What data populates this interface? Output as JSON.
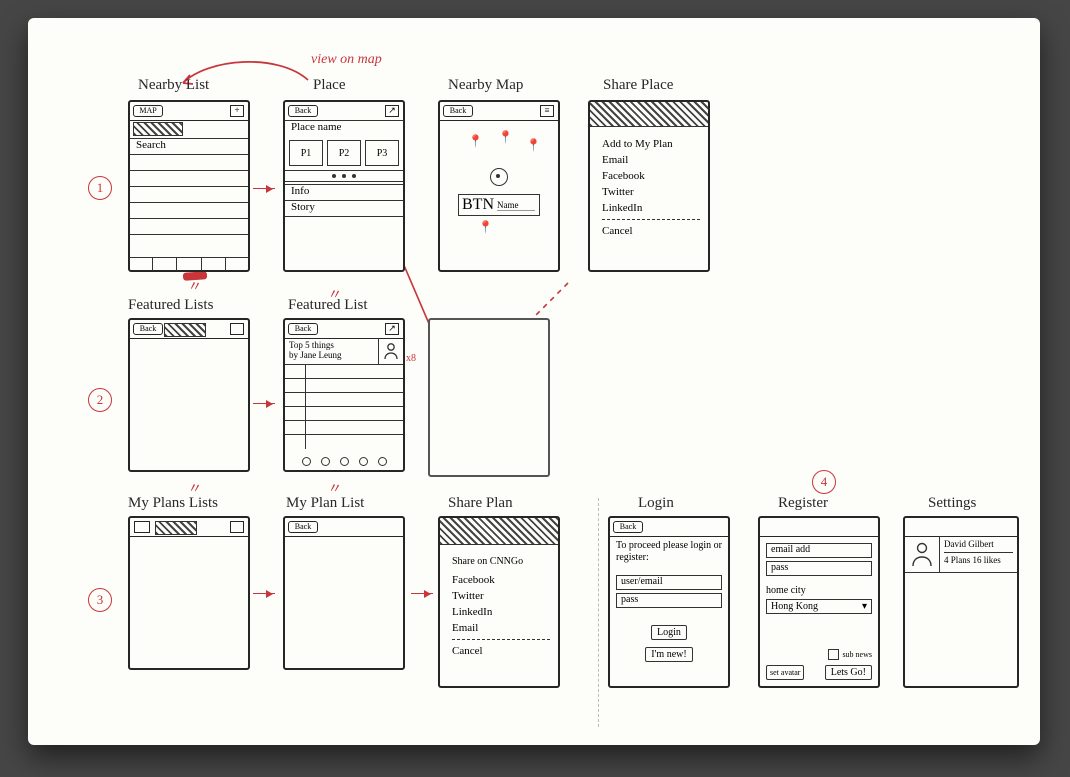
{
  "annotations": {
    "view_on_map": "view on map",
    "row_labels": [
      "1",
      "2",
      "3",
      "4"
    ],
    "x_note": "x8"
  },
  "screens": {
    "nearby_list": {
      "title": "Nearby List",
      "topbar_left": "MAP",
      "topbar_right": "+",
      "search": "Search"
    },
    "place": {
      "title": "Place",
      "back": "Back",
      "share_icon": "↗",
      "name": "Place name",
      "photos": [
        "P1",
        "P2",
        "P3"
      ],
      "info": "Info",
      "story": "Story"
    },
    "nearby_map": {
      "title": "Nearby Map",
      "back": "Back",
      "list_icon": "≡",
      "callout_btn": "BTN",
      "callout_name": "Name"
    },
    "share_place": {
      "title": "Share Place",
      "items": [
        "Add to My Plan",
        "Email",
        "Facebook",
        "Twitter",
        "LinkedIn"
      ],
      "cancel": "Cancel"
    },
    "featured_lists": {
      "title": "Featured Lists",
      "back": "Back"
    },
    "featured_list": {
      "title": "Featured List",
      "back": "Back",
      "list_title": "Top 5 things",
      "byline": "by Jane Leung"
    },
    "my_plans_lists": {
      "title": "My Plans Lists"
    },
    "my_plan_list": {
      "title": "My Plan List",
      "back": "Back"
    },
    "share_plan": {
      "title": "Share Plan",
      "header": "Share on CNNGo",
      "items": [
        "Facebook",
        "Twitter",
        "LinkedIn",
        "Email"
      ],
      "cancel": "Cancel"
    },
    "login": {
      "title": "Login",
      "back": "Back",
      "msg": "To proceed please login or register:",
      "user": "user/email",
      "pass": "pass",
      "login_btn": "Login",
      "new_btn": "I'm new!"
    },
    "register": {
      "title": "Register",
      "email": "email add",
      "pass": "pass",
      "home": "home city",
      "home_val": "Hong Kong",
      "avatar": "set avatar",
      "news": "sub news",
      "go": "Lets Go!"
    },
    "settings": {
      "title": "Settings",
      "name": "David Gilbert",
      "stats": "4 Plans 16 likes"
    }
  }
}
